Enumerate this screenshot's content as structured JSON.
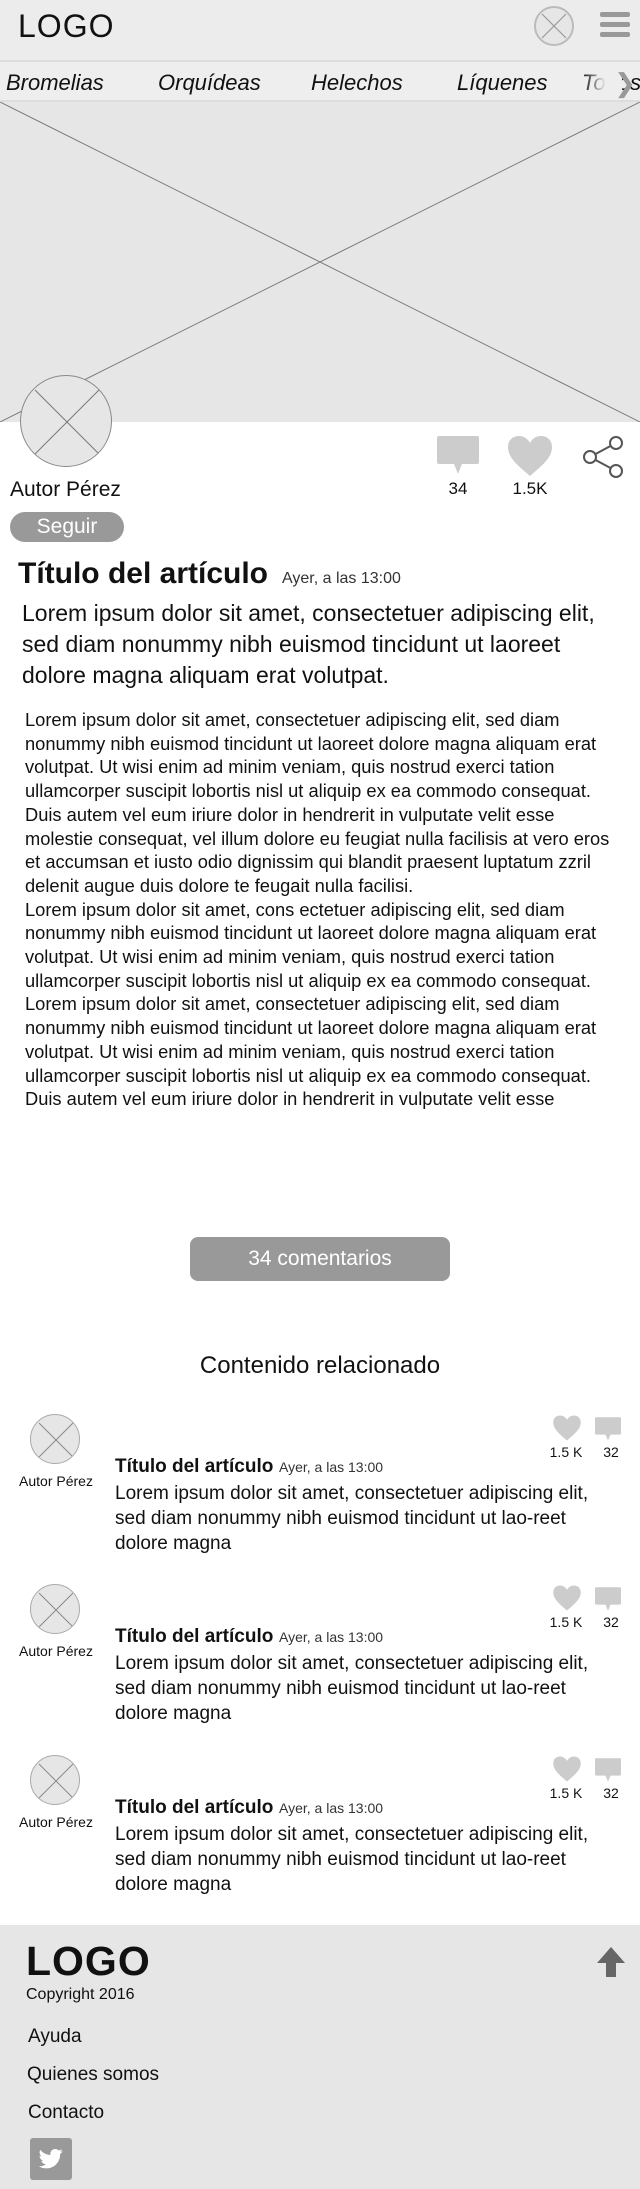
{
  "header": {
    "logo": "LOGO"
  },
  "nav": {
    "items": [
      "Bromelias",
      "Orquídeas",
      "Helechos",
      "Líquenes",
      "Todos"
    ]
  },
  "author": {
    "name": "Autor Pérez",
    "follow_label": "Seguir"
  },
  "stats": {
    "comments": "34",
    "likes": "1.5K"
  },
  "article": {
    "title": "Título del artículo",
    "date": "Ayer, a las 13:00",
    "lead": "Lorem ipsum dolor sit amet, consectetuer adipiscing elit, sed diam nonummy nibh euismod tincidunt ut laoreet dolore magna aliquam erat volutpat.",
    "paragraphs": [
      "Lorem ipsum dolor sit amet, consectetuer adipiscing elit, sed diam nonummy nibh euismod tincidunt ut laoreet dolore magna aliquam erat volutpat. Ut wisi enim ad minim veniam, quis nostrud exerci tation ullamcorper suscipit lobortis nisl ut aliquip ex ea commodo consequat. Duis autem vel eum iriure dolor in hendrerit in vulputate velit esse molestie consequat, vel illum dolore eu feugiat nulla facilisis at vero eros et accumsan et iusto odio dignissim qui blandit praesent luptatum zzril delenit augue duis dolore te feugait nulla facilisi.",
      "Lorem ipsum dolor sit amet, cons ectetuer adipiscing elit, sed diam nonummy nibh euismod tincidunt ut laoreet dolore magna aliquam erat volutpat. Ut wisi enim ad minim veniam, quis nostrud exerci tation ullamcorper suscipit lobortis nisl ut aliquip ex ea commodo consequat.",
      "Lorem ipsum dolor sit amet, consectetuer adipiscing elit, sed diam nonummy nibh euismod tincidunt ut laoreet dolore magna aliquam erat volutpat. Ut wisi enim ad minim veniam, quis nostrud exerci tation ullamcorper suscipit lobortis nisl ut aliquip ex ea commodo consequat. Duis autem vel eum iriure dolor in hendrerit in vulputate velit esse"
    ]
  },
  "comments_button": "34 comentarios",
  "related": {
    "title": "Contenido relacionado",
    "items": [
      {
        "author": "Autor Pérez",
        "likes": "1.5 K",
        "comments": "32",
        "title": "Título del artículo",
        "date": "Ayer, a las 13:00",
        "text": "Lorem ipsum dolor sit amet, consectetuer adipiscing elit, sed diam nonummy nibh euismod tincidunt ut lao-reet dolore magna"
      },
      {
        "author": "Autor Pérez",
        "likes": "1.5 K",
        "comments": "32",
        "title": "Título del artículo",
        "date": "Ayer, a las 13:00",
        "text": "Lorem ipsum dolor sit amet, consectetuer adipiscing elit, sed diam nonummy nibh euismod tincidunt ut lao-reet dolore magna"
      },
      {
        "author": "Autor Pérez",
        "likes": "1.5 K",
        "comments": "32",
        "title": "Título del artículo",
        "date": "Ayer, a las 13:00",
        "text": "Lorem ipsum dolor sit amet, consectetuer adipiscing elit, sed diam nonummy nibh euismod tincidunt ut lao-reet dolore magna"
      }
    ]
  },
  "footer": {
    "logo": "LOGO",
    "copyright": "Copyright 2016",
    "links": [
      "Ayuda",
      "Quienes somos",
      "Contacto"
    ]
  },
  "colors": {
    "placeholder": "#e6e6e6",
    "button": "#999999",
    "footer": "#e6e6e6"
  }
}
